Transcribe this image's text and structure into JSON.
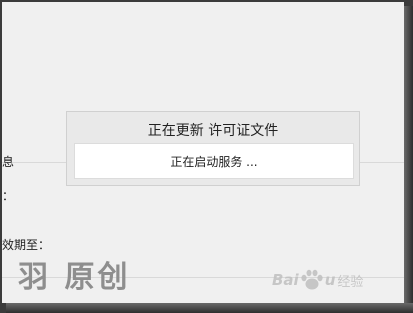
{
  "background": {
    "labels": [
      "息",
      "：",
      "效期至："
    ]
  },
  "dialog": {
    "title": "正在更新 许可证文件",
    "status": "正在启动服务 ..."
  },
  "watermark": {
    "text": "羽 原创"
  },
  "baidu": {
    "left": "Bai",
    "right": "u",
    "jingyan": "经验"
  },
  "colors": {
    "window": "#f0f0f0",
    "dialog": "#e9e9e9",
    "dialog_body": "#ffffff",
    "watermark": "#8e8e8e"
  }
}
